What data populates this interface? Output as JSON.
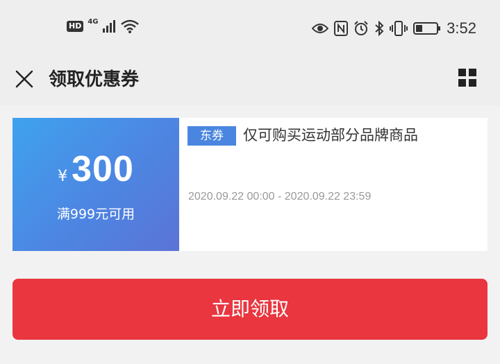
{
  "status_bar": {
    "hd": "HD",
    "network": "4G",
    "time": "3:52"
  },
  "header": {
    "title": "领取优惠券"
  },
  "coupon": {
    "currency": "¥",
    "amount": "300",
    "condition": "满999元可用",
    "tag": "东券",
    "description": "仅可购买运动部分品牌商品",
    "validity": "2020.09.22 00:00 - 2020.09.22 23:59",
    "colors": {
      "gradient_start": "#3fa2ef",
      "gradient_end": "#5b73d6",
      "tag_bg": "#4a86df"
    }
  },
  "claim_button": {
    "label": "立即领取",
    "color": "#e9363f"
  }
}
